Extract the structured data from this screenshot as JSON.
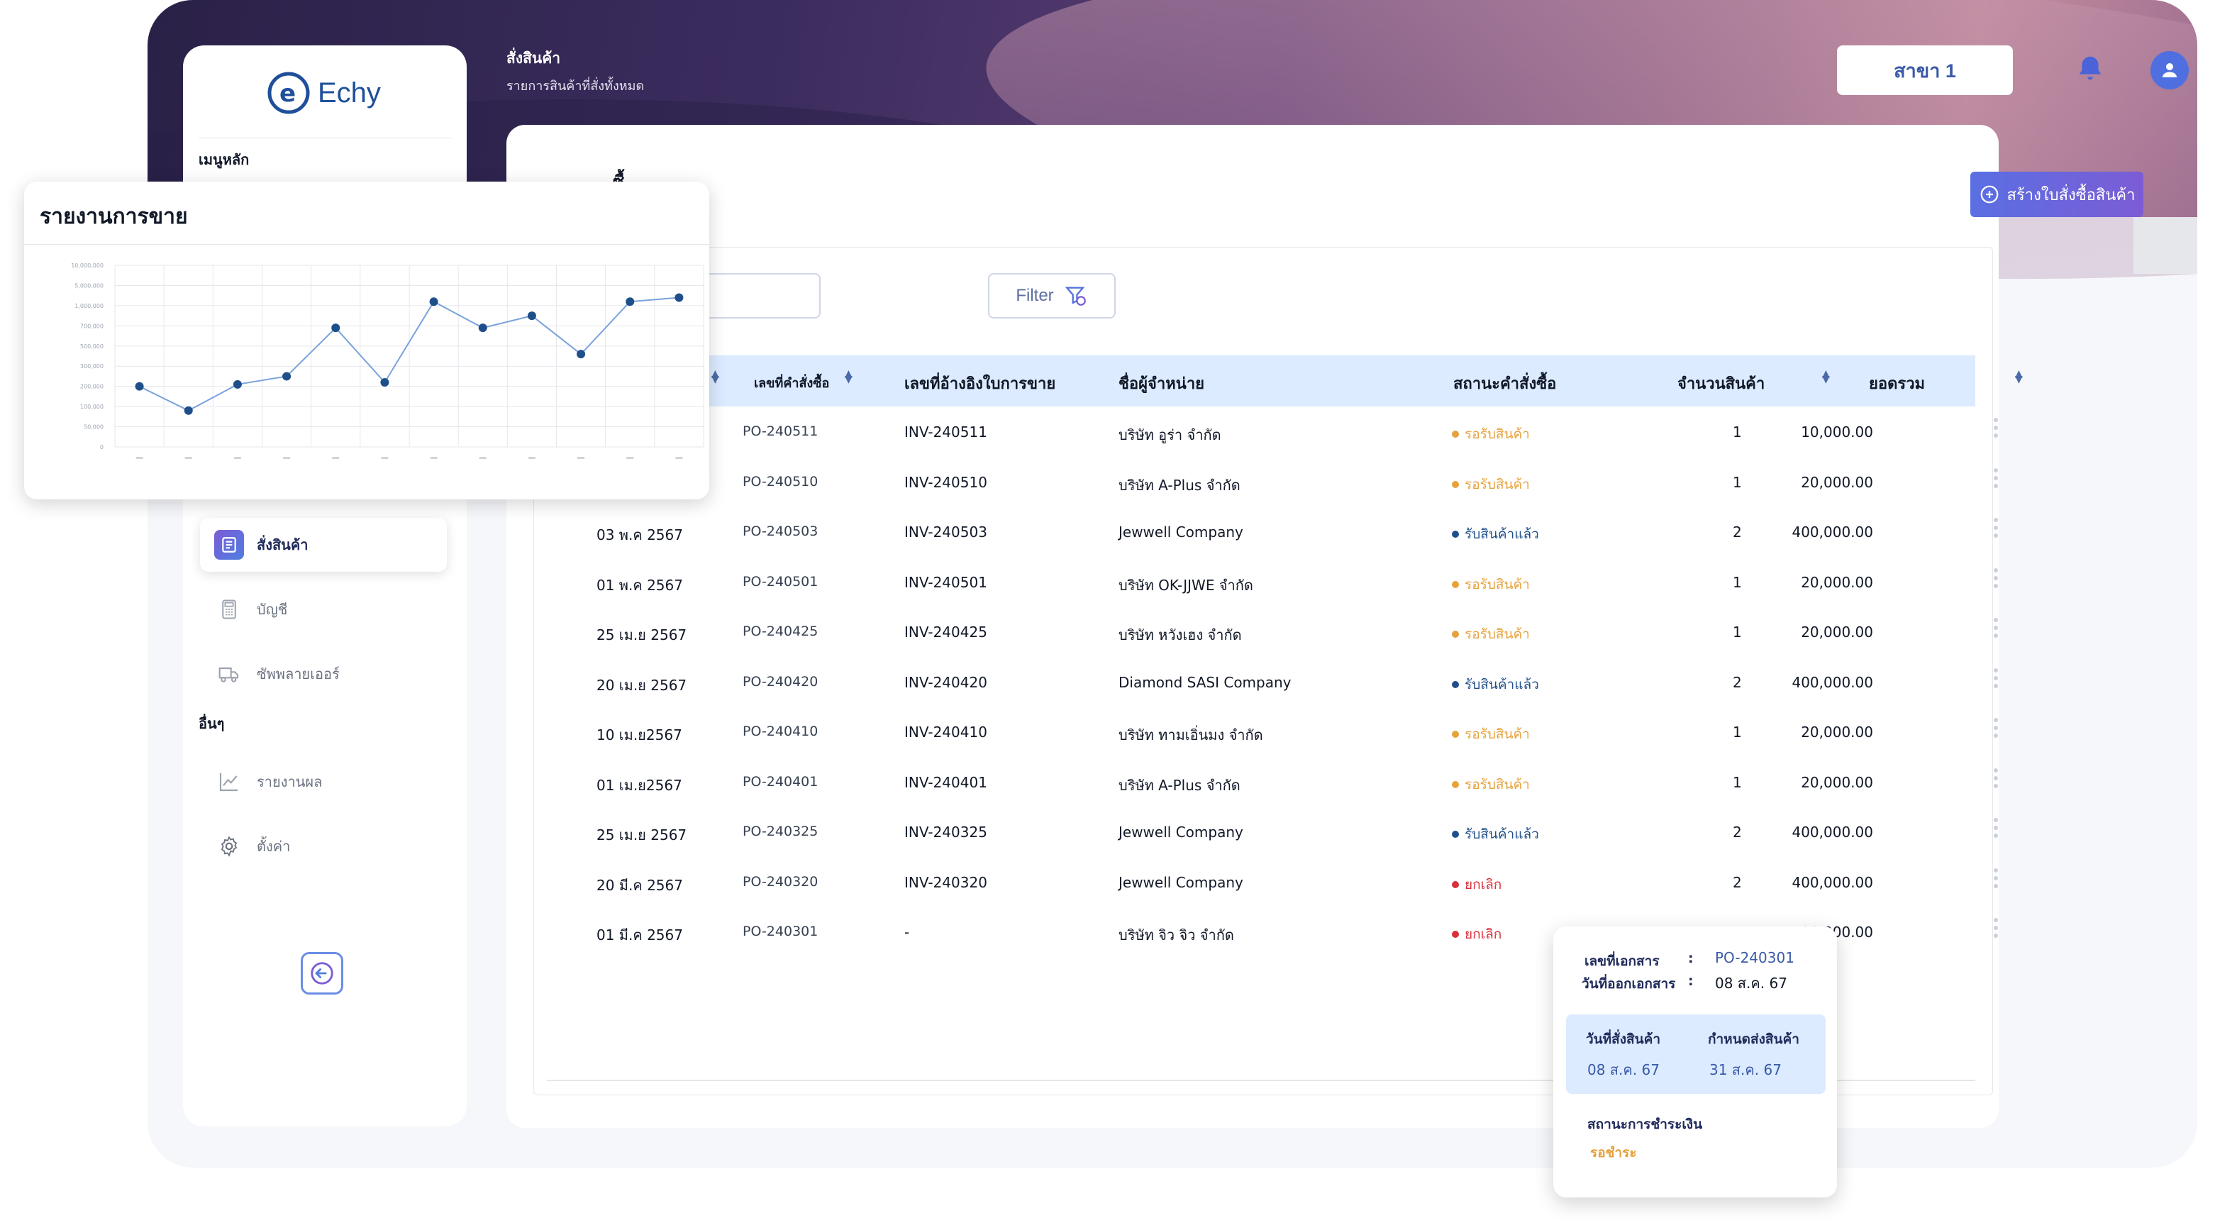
{
  "header": {
    "title": "สั่งสินค้า",
    "subtitle": "รายการสินค้าที่สั่งทั้งหมด",
    "branch": "สาขา 1"
  },
  "brand": {
    "name": "Echy"
  },
  "sidebar": {
    "menu_heading": "เมนูหลัก",
    "other_heading": "อื่นๆ",
    "items": [
      {
        "label": "สั่งสินค้า",
        "icon": "order-list-icon",
        "active": true
      },
      {
        "label": "บัญชี",
        "icon": "calculator-icon"
      },
      {
        "label": "ซัพพลายเออร์",
        "icon": "truck-icon"
      }
    ],
    "other_items": [
      {
        "label": "รายงานผล",
        "icon": "trend-chart-icon"
      },
      {
        "label": "ตั้งค่า",
        "icon": "gear-icon"
      }
    ]
  },
  "main": {
    "title_partial": "ซื้",
    "create_button": "สร้างใบสั่งซื้อสินค้า",
    "search_placeholder": "อง",
    "filter_label": "Filter"
  },
  "table": {
    "headers": {
      "po": "เลขที่คำสั่งซื้อ",
      "invoice": "เลขที่อ้างอิงใบการขาย",
      "vendor": "ชื่อผู้จำหน่าย",
      "status": "สถานะคำสั่งซื้อ",
      "qty": "จำนวนสินค้า",
      "total": "ยอดรวม"
    },
    "rows": [
      {
        "date": "",
        "po": "PO-240511",
        "invoice": "INV-240511",
        "vendor": "บริษัท อูร่า จำกัด",
        "status": "รอรับสินค้า",
        "status_type": "pending",
        "qty": "1",
        "total": "10,000.00"
      },
      {
        "date": "",
        "po": "PO-240510",
        "invoice": "INV-240510",
        "vendor": "บริษัท  A-Plus จำกัด",
        "status": "รอรับสินค้า",
        "status_type": "pending",
        "qty": "1",
        "total": "20,000.00"
      },
      {
        "date": "03 พ.ค 2567",
        "po": "PO-240503",
        "invoice": "INV-240503",
        "vendor": "Jewwell Company",
        "status": "รับสินค้าแล้ว",
        "status_type": "received",
        "qty": "2",
        "total": "400,000.00"
      },
      {
        "date": "01 พ.ค 2567",
        "po": "PO-240501",
        "invoice": "INV-240501",
        "vendor": "บริษัท  OK-JJWE จำกัด",
        "status": "รอรับสินค้า",
        "status_type": "pending",
        "qty": "1",
        "total": "20,000.00"
      },
      {
        "date": "25 เม.ย 2567",
        "po": "PO-240425",
        "invoice": "INV-240425",
        "vendor": "บริษัท  หวังเฮง  จำกัด",
        "status": "รอรับสินค้า",
        "status_type": "pending",
        "qty": "1",
        "total": "20,000.00"
      },
      {
        "date": "20 เม.ย 2567",
        "po": "PO-240420",
        "invoice": "INV-240420",
        "vendor": "Diamond SASI Company",
        "status": "รับสินค้าแล้ว",
        "status_type": "received",
        "qty": "2",
        "total": "400,000.00"
      },
      {
        "date": "10 เม.ย2567",
        "po": "PO-240410",
        "invoice": "INV-240410",
        "vendor": "บริษัท ทามเอิ่นมง จำกัด",
        "status": "รอรับสินค้า",
        "status_type": "pending",
        "qty": "1",
        "total": "20,000.00"
      },
      {
        "date": "01 เม.ย2567",
        "po": "PO-240401",
        "invoice": "INV-240401",
        "vendor": "บริษัท  A-Plus จำกัด",
        "status": "รอรับสินค้า",
        "status_type": "pending",
        "qty": "1",
        "total": "20,000.00"
      },
      {
        "date": "25 เม.ย 2567",
        "po": "PO-240325",
        "invoice": "INV-240325",
        "vendor": "Jewwell Company",
        "status": "รับสินค้าแล้ว",
        "status_type": "received",
        "qty": "2",
        "total": "400,000.00"
      },
      {
        "date": "20 มี.ค 2567",
        "po": "PO-240320",
        "invoice": "INV-240320",
        "vendor": "Jewwell Company",
        "status": "ยกเลิก",
        "status_type": "cancelled",
        "qty": "2",
        "total": "400,000.00"
      },
      {
        "date": "01 มี.ค 2567",
        "po": "PO-240301",
        "invoice": "-",
        "vendor": "บริษัท จิว จิว จำกัด",
        "status": "ยกเลิก",
        "status_type": "cancelled",
        "qty": "",
        "total": "1,500,000.00"
      }
    ]
  },
  "status_colors": {
    "pending": "#e6a23c",
    "received": "#1f4f8a",
    "cancelled": "#d9303b"
  },
  "report": {
    "title": "รายงานการขาย",
    "chart_data": {
      "type": "line",
      "y_ticks": [
        "0",
        "50,000",
        "100,000",
        "200,000",
        "300,000",
        "500,000",
        "700,000",
        "1,000,000",
        "5,000,000",
        "10,000,000"
      ],
      "values": [
        3,
        1.8,
        3.1,
        3.5,
        5.9,
        3.2,
        7.2,
        5.9,
        6.5,
        4.6,
        7.2,
        7.4
      ],
      "ylim": [
        0,
        9
      ],
      "color": "#1f4f8a",
      "grid": true
    }
  },
  "popup": {
    "doc_no_label": "เลขที่เอกสาร",
    "doc_no": "PO-240301",
    "doc_date_label": "วันที่ออกเอกสาร",
    "doc_date": "08 ส.ค. 67",
    "sep": ":",
    "order_date_label": "วันที่สั่งสินค้า",
    "order_date": "08 ส.ค. 67",
    "due_label": "กำหนดส่งสินค้า",
    "due_date": "31 ส.ค. 67",
    "payment_label": "สถานะการชำระเงิน",
    "payment_status": "รอชำระ"
  }
}
